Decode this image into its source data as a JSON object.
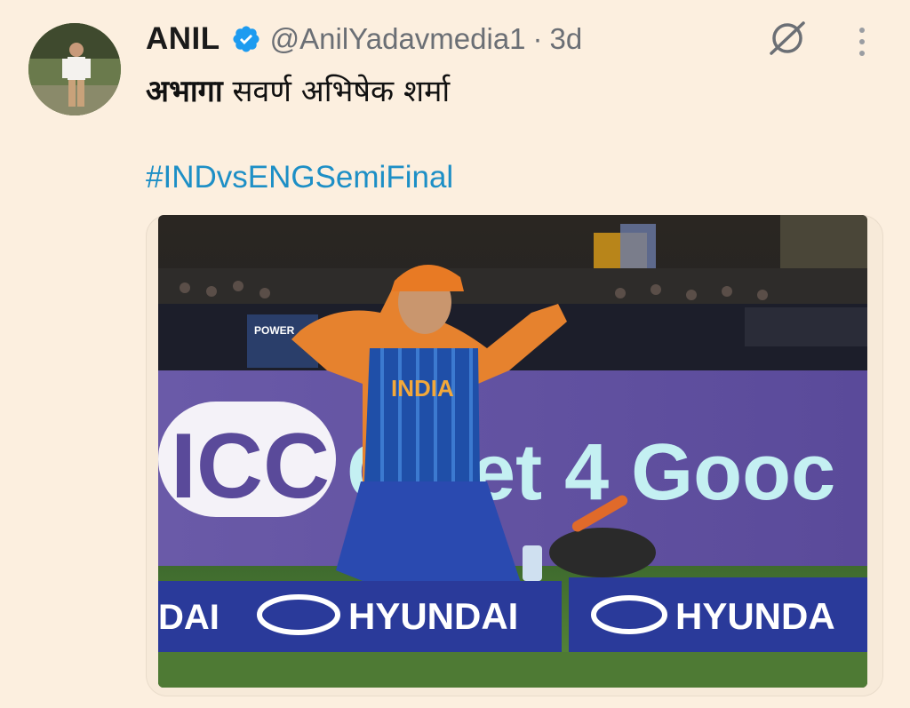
{
  "tweet": {
    "author_name": "ANIL",
    "handle": "@AnilYadavmedia1",
    "separator": "·",
    "time": "3d",
    "text_bold": "अभागा",
    "text_rest": " सवर्ण अभिषेक शर्मा",
    "hashtag": "#INDvsENGSemiFinal"
  },
  "photo": {
    "jersey_text": "INDIA",
    "board_icc": "ICC",
    "board_tagline": "C   ket 4 Gooc",
    "hoarding_brand": "HYUNDAI",
    "hoarding_left_fragment": "DAI",
    "hoarding_right_fragment": "HYUNDA",
    "small_board": "POWER"
  },
  "colors": {
    "background": "#fcefdf",
    "hashtag": "#1d8fc6",
    "verified": "#1d9bf0"
  }
}
